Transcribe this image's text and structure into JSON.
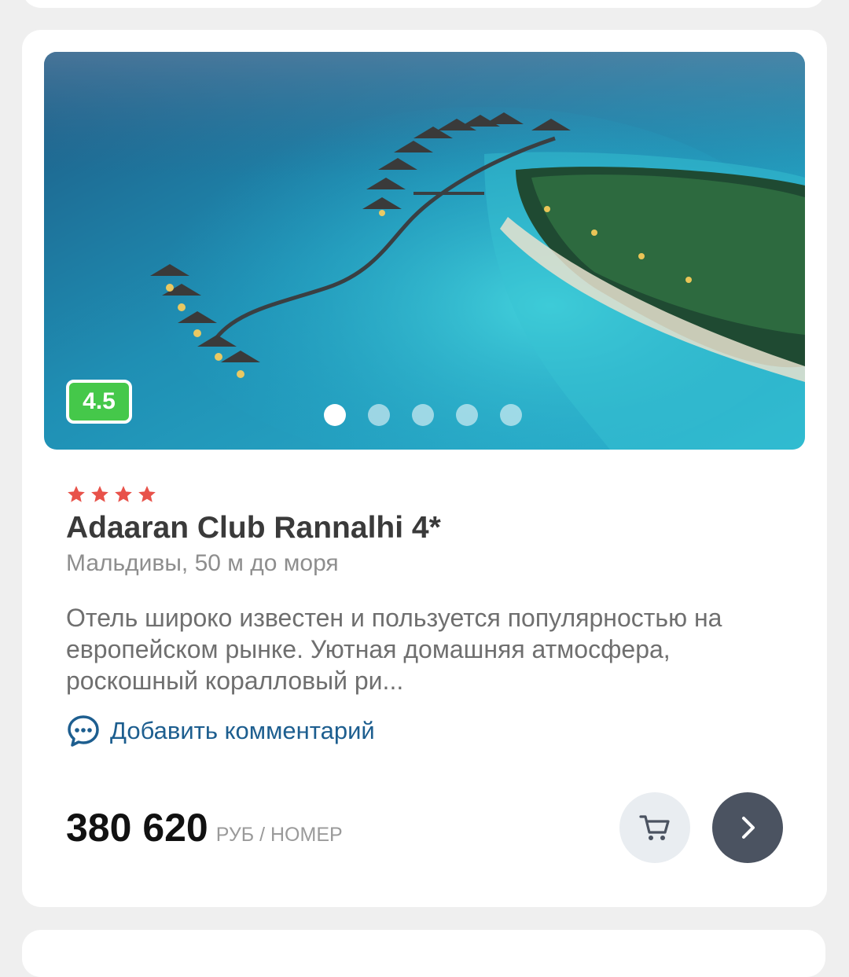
{
  "hotel": {
    "rating": "4.5",
    "star_count": 4,
    "name": "Adaaran Club Rannalhi 4*",
    "location": "Мальдивы, 50 м до моря",
    "description": "Отель широко известен и пользуется популярностью на европейском рынке. Уютная домашняя атмосфера, роскошный коралловый ри...",
    "photo_dots": 5,
    "active_photo": 1
  },
  "actions": {
    "comment_label": "Добавить комментарий",
    "cart_icon": "cart-icon",
    "next_icon": "chevron-right-icon"
  },
  "price": {
    "value": "380 620",
    "unit": "РУБ / НОМЕР"
  },
  "colors": {
    "rating_badge": "#45c84a",
    "stars": "#e8524a",
    "link": "#1d5e8f",
    "next_button": "#4b5361",
    "cart_button": "#e9edf1"
  }
}
